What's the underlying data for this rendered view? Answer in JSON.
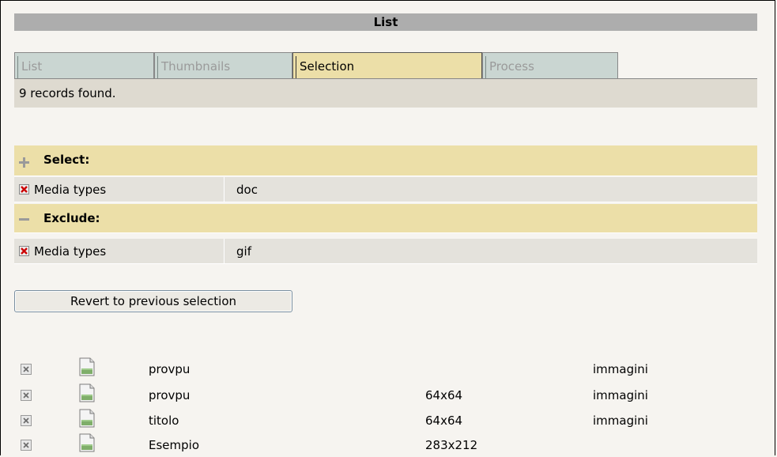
{
  "title": "List",
  "tabs": [
    {
      "label": "List",
      "active": false
    },
    {
      "label": "Thumbnails",
      "active": false
    },
    {
      "label": "Selection",
      "active": true
    },
    {
      "label": "Process",
      "active": false
    }
  ],
  "status": "9 records found.",
  "select": {
    "label": "Select:",
    "items": [
      {
        "name": "Media types",
        "value": "doc"
      }
    ]
  },
  "exclude": {
    "label": "Exclude:",
    "items": [
      {
        "name": "Media types",
        "value": "gif"
      }
    ]
  },
  "revert_button": "Revert to previous selection",
  "records": [
    {
      "title": "provpu",
      "size": "",
      "category": "immagini"
    },
    {
      "title": "provpu",
      "size": "64x64",
      "category": "immagini"
    },
    {
      "title": "titolo",
      "size": "64x64",
      "category": "immagini"
    },
    {
      "title": "Esempio",
      "size": "283x212",
      "category": ""
    }
  ],
  "colors": {
    "title_bar": "#adadad",
    "tab_active": "#ecdfa8",
    "tab_inactive": "#cad6d2",
    "status_bg": "#dedad0",
    "section_bg": "#ecdfa8",
    "criteria_bg": "#e4e2dc",
    "remove_red": "#cc0000"
  },
  "icons": {
    "select_section": "plus-icon",
    "exclude_section": "minus-icon",
    "remove_criteria": "remove-icon",
    "remove_record": "remove-icon",
    "record_type": "document-icon"
  }
}
